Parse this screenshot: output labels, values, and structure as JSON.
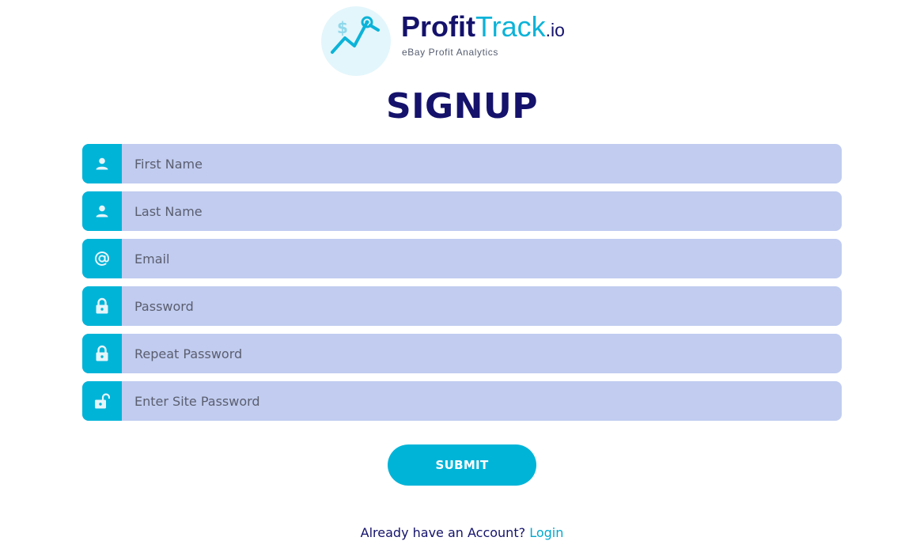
{
  "logo": {
    "name_part1": "Profit",
    "name_part2": "Track",
    "name_suffix": ".io",
    "tagline": "eBay Profit Analytics",
    "icon": "chart-magnifier-icon"
  },
  "title": "SIGNUP",
  "fields": [
    {
      "placeholder": "First Name",
      "icon": "user-icon",
      "type": "text"
    },
    {
      "placeholder": "Last Name",
      "icon": "user-icon",
      "type": "text"
    },
    {
      "placeholder": "Email",
      "icon": "at-icon",
      "type": "email"
    },
    {
      "placeholder": "Password",
      "icon": "lock-icon",
      "type": "password"
    },
    {
      "placeholder": "Repeat Password",
      "icon": "lock-icon",
      "type": "password"
    },
    {
      "placeholder": "Enter Site Password",
      "icon": "unlock-icon",
      "type": "password"
    }
  ],
  "submit_label": "SUBMIT",
  "footer": {
    "prompt": "Already have an Account?",
    "link_label": "Login"
  },
  "colors": {
    "accent": "#00b4d8",
    "navy": "#14126b",
    "field_bg": "#c1ccf0"
  }
}
